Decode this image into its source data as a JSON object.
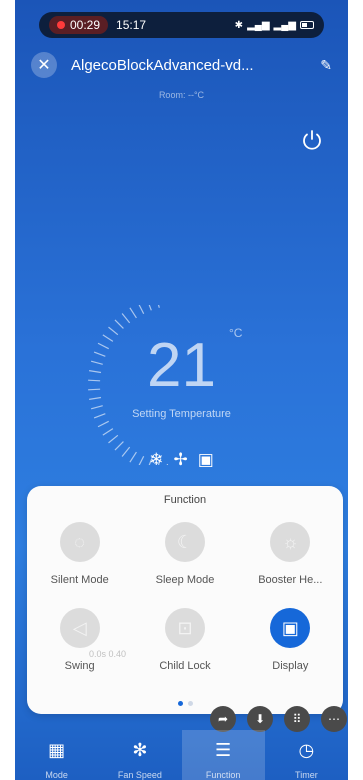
{
  "status_bar": {
    "recording_time": "00:29",
    "clock": "15:17"
  },
  "header": {
    "title": "AlgecoBlockAdvanced-vd...",
    "subtitle": "Room: --°C"
  },
  "thermostat": {
    "temperature": "21",
    "unit": "°C",
    "label": "Setting Temperature"
  },
  "function_panel": {
    "title": "Function",
    "items": [
      {
        "label": "Silent Mode",
        "icon": "silent-icon",
        "active": false
      },
      {
        "label": "Sleep Mode",
        "icon": "moon-icon",
        "active": false
      },
      {
        "label": "Booster He...",
        "icon": "sun-icon",
        "active": false
      },
      {
        "label": "Swing",
        "icon": "swing-icon",
        "active": false
      },
      {
        "label": "Child Lock",
        "icon": "lock-icon",
        "active": false
      },
      {
        "label": "Display",
        "icon": "display-icon",
        "active": true
      }
    ],
    "ghost_text": "0.0s  0.40",
    "page_count": 2,
    "current_page": 1
  },
  "tab_bar": {
    "tabs": [
      {
        "label": "Mode",
        "icon": "mode-icon"
      },
      {
        "label": "Fan Speed",
        "icon": "fan-icon"
      },
      {
        "label": "Function",
        "icon": "menu-icon"
      },
      {
        "label": "Timer",
        "icon": "clock-icon"
      }
    ],
    "active_index": 2
  },
  "colors": {
    "accent": "#1668d9",
    "background_top": "#1b55b8",
    "background_bottom": "#2e7ee0"
  }
}
